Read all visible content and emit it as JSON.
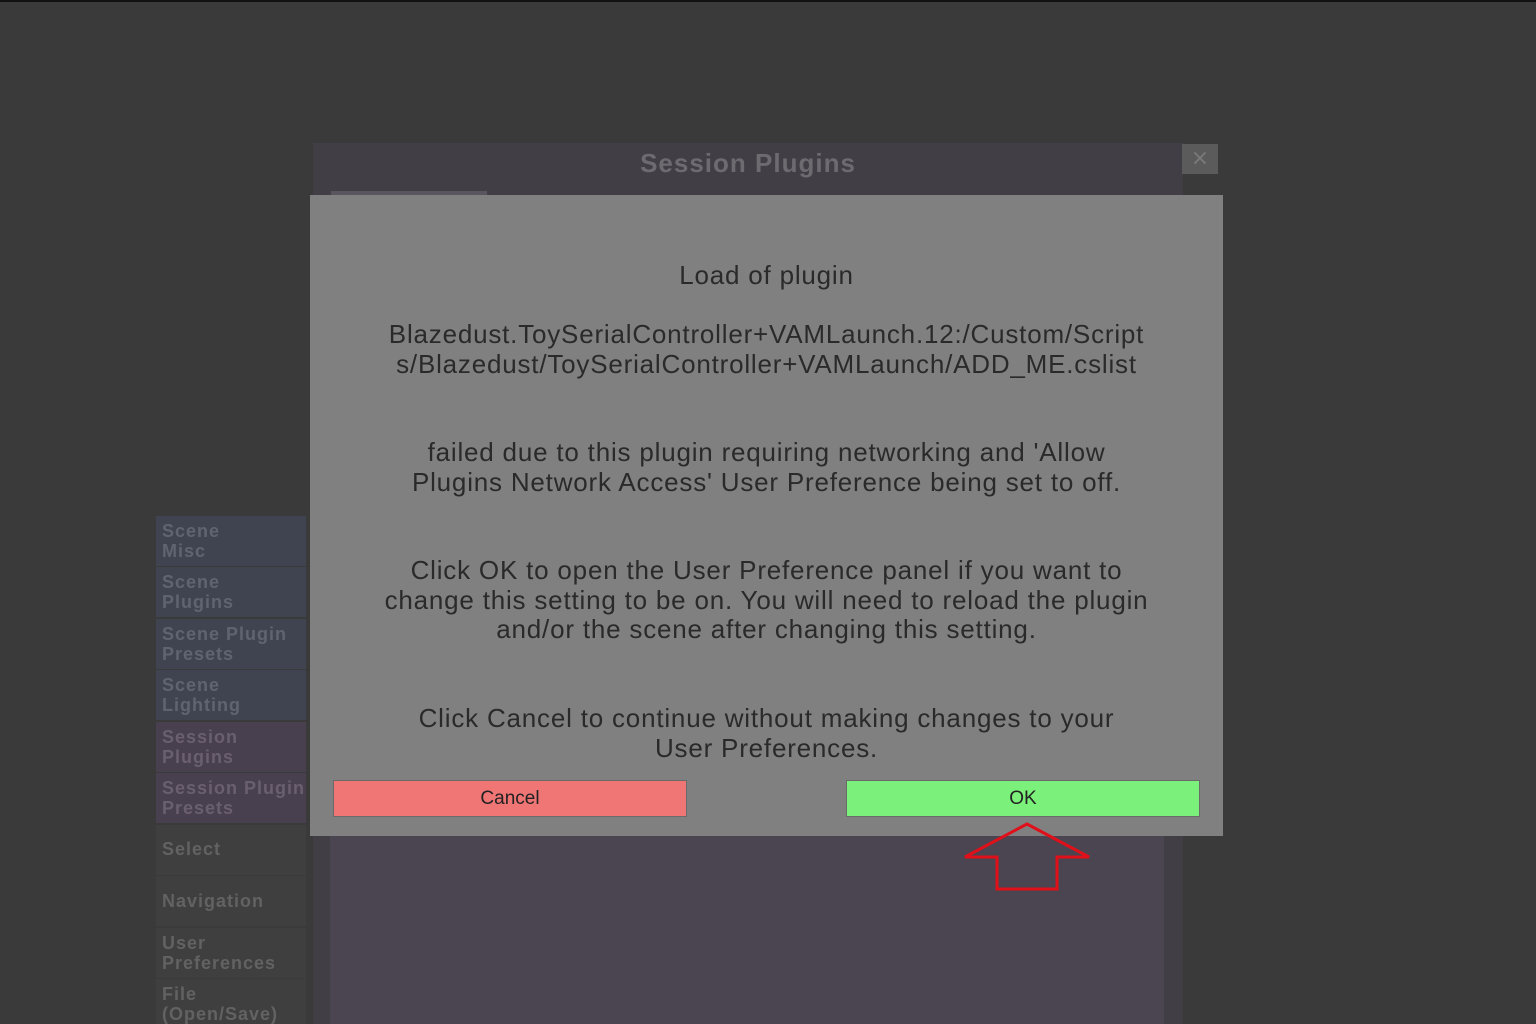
{
  "background_panel": {
    "title": "Session Plugins",
    "close_glyph": "×"
  },
  "side_menu": {
    "items": [
      {
        "label_line1": "Scene",
        "label_line2": "Misc"
      },
      {
        "label_line1": "Scene",
        "label_line2": "Plugins"
      },
      {
        "label_line1": "Scene Plugin",
        "label_line2": "Presets"
      },
      {
        "label_line1": "Scene",
        "label_line2": "Lighting"
      },
      {
        "label_line1": "Session",
        "label_line2": "Plugins"
      },
      {
        "label_line1": "Session Plugin",
        "label_line2": "Presets"
      },
      {
        "label_line1": "Select",
        "label_line2": ""
      },
      {
        "label_line1": "Navigation",
        "label_line2": ""
      },
      {
        "label_line1": "User",
        "label_line2": "Preferences"
      },
      {
        "label_line1": "File",
        "label_line2": "(Open/Save)"
      }
    ]
  },
  "dialog": {
    "heading": "Load of plugin",
    "plugin_path": "Blazedust.ToySerialController+VAMLaunch.12:/Custom/Scripts/Blazedust/ToySerialController+VAMLaunch/ADD_ME.cslist",
    "reason": "failed due to this plugin requiring networking and 'Allow Plugins Network Access' User Preference being set to off.",
    "ok_instruction": "Click OK to open the User Preference panel if you want to change this setting to be on. You will need to reload the plugin and/or the scene after changing this setting.",
    "cancel_instruction": "Click Cancel to continue without making changes to your User Preferences.",
    "cancel_label": "Cancel",
    "ok_label": "OK"
  },
  "colors": {
    "cancel_button": "#f07575",
    "ok_button": "#7bf07b",
    "annotation_arrow": "#e0101a"
  },
  "annotation": {
    "icon": "up-arrow-icon"
  }
}
